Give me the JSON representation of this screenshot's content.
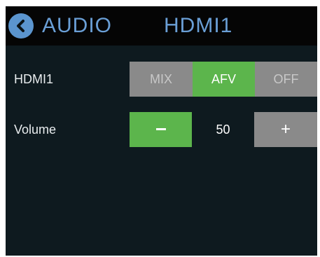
{
  "header": {
    "back_icon": "chevron-left-icon",
    "section": "AUDIO",
    "source": "HDMI1"
  },
  "source_row": {
    "label": "HDMI1",
    "options": [
      "MIX",
      "AFV",
      "OFF"
    ],
    "selected": "AFV"
  },
  "volume_row": {
    "label": "Volume",
    "value": "50",
    "decrease_icon": "minus-icon",
    "increase_label": "+"
  },
  "colors": {
    "accent": "#5cb54c",
    "title": "#6a9fd6",
    "back_button": "#5b95cf",
    "inactive": "#8a8a8a",
    "background": "#0e1a1f",
    "header": "#050505"
  }
}
